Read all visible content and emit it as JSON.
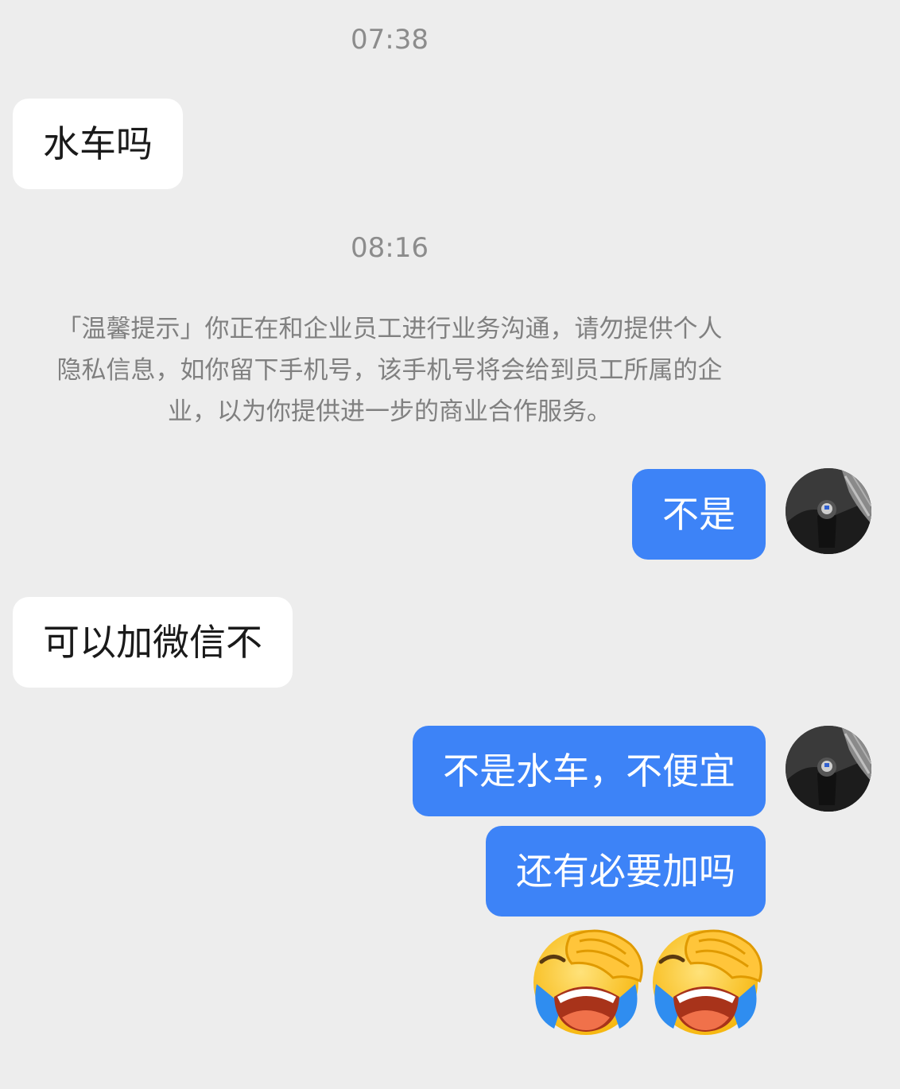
{
  "chat": {
    "timestamps": [
      "07:38",
      "08:16"
    ],
    "notice": [
      "「温馨提示」你正在和企业员工进行业务沟通，请勿提供个人",
      "隐私信息，如你留下手机号，该手机号将会给到员工所属的企",
      "业，以为你提供进一步的商业合作服务。"
    ],
    "messages": [
      {
        "side": "incoming",
        "text": "水车吗"
      },
      {
        "side": "outgoing",
        "text": "不是"
      },
      {
        "side": "incoming",
        "text": "可以加微信不"
      },
      {
        "side": "outgoing",
        "text": "不是水车，不便宜"
      },
      {
        "side": "outgoing",
        "text": "还有必要加吗"
      }
    ],
    "emojis": [
      "facepalm-crying-emoji",
      "facepalm-crying-emoji"
    ],
    "avatar_icon": "gear-shift-avatar"
  },
  "colors": {
    "background": "#ededed",
    "outgoing_bubble": "#3d83f7",
    "incoming_bubble": "#ffffff"
  }
}
